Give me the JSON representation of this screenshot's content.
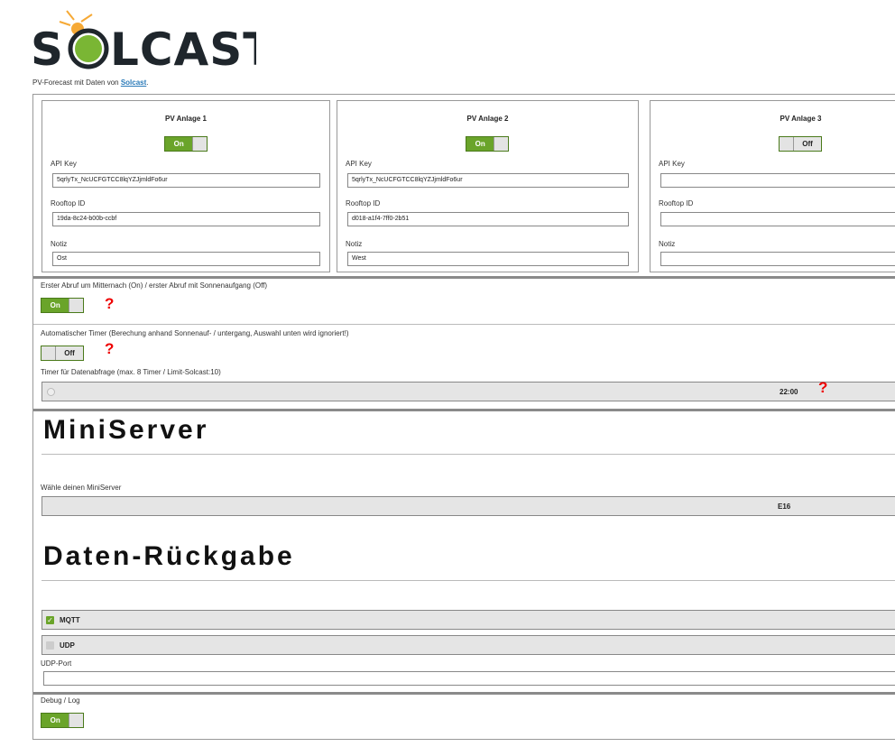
{
  "header": {
    "logo_text": "SOLCAST",
    "subtitle": "PV-Forecast mit Daten von",
    "link": "Solcast",
    "period": "."
  },
  "plants": [
    {
      "title": "PV Anlage 1",
      "toggle": "On",
      "api_key_label": "API Key",
      "api_key": "5qrlyTx_NcUCFGTCC8lqYZJjmldFo6ur",
      "rooftop_label": "Rooftop ID",
      "rooftop": "19da-8c24-b00b-ccbf",
      "note_label": "Notiz",
      "note": "Ost"
    },
    {
      "title": "PV Anlage 2",
      "toggle": "On",
      "api_key_label": "API Key",
      "api_key": "5qrlyTx_NcUCFGTCC8lqYZJjmldFo6ur",
      "rooftop_label": "Rooftop ID",
      "rooftop": "d018-a1f4-7ff0-2b51",
      "note_label": "Notiz",
      "note": "West"
    },
    {
      "title": "PV Anlage 3",
      "toggle": "Off",
      "api_key_label": "API Key",
      "api_key": "",
      "rooftop_label": "Rooftop ID",
      "rooftop": "",
      "note_label": "Notiz",
      "note": ""
    }
  ],
  "first_call": {
    "label": "Erster Abruf um Mitternach (On) / erster Abruf mit Sonnenaufgang (Off)",
    "toggle": "On",
    "help": "?"
  },
  "auto_timer": {
    "label": "Automatischer Timer (Berechung anhand Sonnenauf- / untergang, Auswahl unten wird ignoriert!)",
    "toggle": "Off",
    "help": "?"
  },
  "timer": {
    "label": "Timer für Datenabfrage (max. 8 Timer / Limit-Solcast:10)",
    "value": "22:00",
    "help": "?"
  },
  "miniserver": {
    "heading": "MiniServer",
    "label": "Wähle deinen MiniServer",
    "value": "E16"
  },
  "return": {
    "heading": "Daten-Rückgabe",
    "mqtt": "MQTT",
    "mqtt_checked": true,
    "udp": "UDP",
    "udp_checked": false,
    "udp_port_label": "UDP-Port",
    "udp_port": ""
  },
  "debug": {
    "label": "Debug / Log",
    "toggle": "On"
  },
  "colors": {
    "accent": "#6aa42a",
    "help": "#ee0000"
  }
}
